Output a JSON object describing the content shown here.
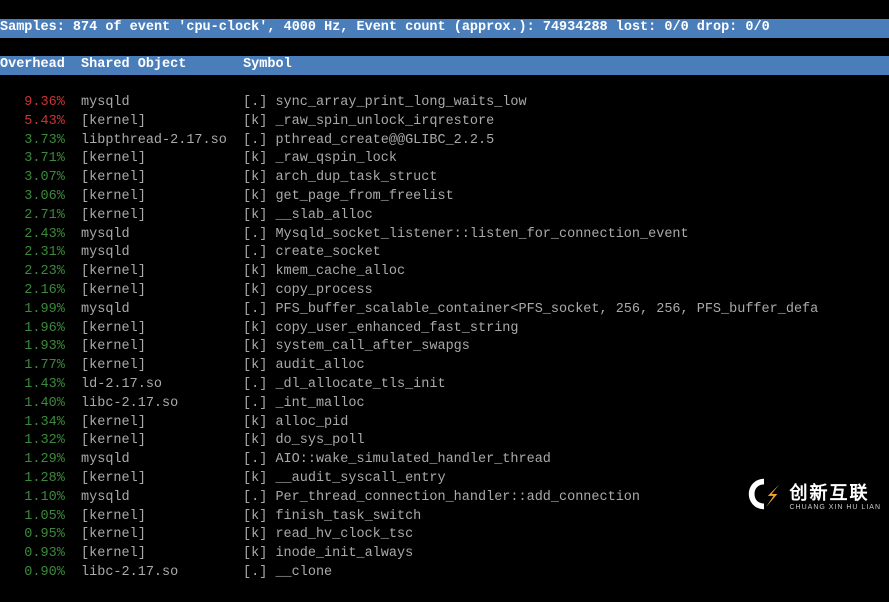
{
  "header": {
    "samples_label": "Samples:",
    "samples": "874",
    "of_event": " of event '",
    "event": "cpu-clock",
    "hz": ", 4000 Hz, Event count (approx.): ",
    "count": "74934288",
    "lost": " lost: 0/0 drop: 0/0"
  },
  "columns": {
    "overhead": "Overhead",
    "shared": "Shared Object",
    "symbol": "Symbol"
  },
  "rows": [
    {
      "pct": "9.36%",
      "obj": "mysqld",
      "flag": "[.]",
      "sym": "sync_array_print_long_waits_low",
      "c": "pct-high"
    },
    {
      "pct": "5.43%",
      "obj": "[kernel]",
      "flag": "[k]",
      "sym": "_raw_spin_unlock_irqrestore",
      "c": "pct-high"
    },
    {
      "pct": "3.73%",
      "obj": "libpthread-2.17.so",
      "flag": "[.]",
      "sym": "pthread_create@@GLIBC_2.2.5",
      "c": "pct-low"
    },
    {
      "pct": "3.71%",
      "obj": "[kernel]",
      "flag": "[k]",
      "sym": "_raw_qspin_lock",
      "c": "pct-low"
    },
    {
      "pct": "3.07%",
      "obj": "[kernel]",
      "flag": "[k]",
      "sym": "arch_dup_task_struct",
      "c": "pct-low"
    },
    {
      "pct": "3.06%",
      "obj": "[kernel]",
      "flag": "[k]",
      "sym": "get_page_from_freelist",
      "c": "pct-low"
    },
    {
      "pct": "2.71%",
      "obj": "[kernel]",
      "flag": "[k]",
      "sym": "__slab_alloc",
      "c": "pct-low"
    },
    {
      "pct": "2.43%",
      "obj": "mysqld",
      "flag": "[.]",
      "sym": "Mysqld_socket_listener::listen_for_connection_event",
      "c": "pct-low"
    },
    {
      "pct": "2.31%",
      "obj": "mysqld",
      "flag": "[.]",
      "sym": "create_socket",
      "c": "pct-low"
    },
    {
      "pct": "2.23%",
      "obj": "[kernel]",
      "flag": "[k]",
      "sym": "kmem_cache_alloc",
      "c": "pct-low"
    },
    {
      "pct": "2.16%",
      "obj": "[kernel]",
      "flag": "[k]",
      "sym": "copy_process",
      "c": "pct-low"
    },
    {
      "pct": "1.99%",
      "obj": "mysqld",
      "flag": "[.]",
      "sym": "PFS_buffer_scalable_container<PFS_socket, 256, 256, PFS_buffer_defa",
      "c": "pct-low"
    },
    {
      "pct": "1.96%",
      "obj": "[kernel]",
      "flag": "[k]",
      "sym": "copy_user_enhanced_fast_string",
      "c": "pct-low"
    },
    {
      "pct": "1.93%",
      "obj": "[kernel]",
      "flag": "[k]",
      "sym": "system_call_after_swapgs",
      "c": "pct-low"
    },
    {
      "pct": "1.77%",
      "obj": "[kernel]",
      "flag": "[k]",
      "sym": "audit_alloc",
      "c": "pct-low"
    },
    {
      "pct": "1.43%",
      "obj": "ld-2.17.so",
      "flag": "[.]",
      "sym": "_dl_allocate_tls_init",
      "c": "pct-low"
    },
    {
      "pct": "1.40%",
      "obj": "libc-2.17.so",
      "flag": "[.]",
      "sym": "_int_malloc",
      "c": "pct-low"
    },
    {
      "pct": "1.34%",
      "obj": "[kernel]",
      "flag": "[k]",
      "sym": "alloc_pid",
      "c": "pct-low"
    },
    {
      "pct": "1.32%",
      "obj": "[kernel]",
      "flag": "[k]",
      "sym": "do_sys_poll",
      "c": "pct-low"
    },
    {
      "pct": "1.29%",
      "obj": "mysqld",
      "flag": "[.]",
      "sym": "AIO::wake_simulated_handler_thread",
      "c": "pct-low"
    },
    {
      "pct": "1.28%",
      "obj": "[kernel]",
      "flag": "[k]",
      "sym": "__audit_syscall_entry",
      "c": "pct-low"
    },
    {
      "pct": "1.10%",
      "obj": "mysqld",
      "flag": "[.]",
      "sym": "Per_thread_connection_handler::add_connection",
      "c": "pct-low"
    },
    {
      "pct": "1.05%",
      "obj": "[kernel]",
      "flag": "[k]",
      "sym": "finish_task_switch",
      "c": "pct-low"
    },
    {
      "pct": "0.95%",
      "obj": "[kernel]",
      "flag": "[k]",
      "sym": "read_hv_clock_tsc",
      "c": "pct-low"
    },
    {
      "pct": "0.93%",
      "obj": "[kernel]",
      "flag": "[k]",
      "sym": "inode_init_always",
      "c": "pct-low"
    },
    {
      "pct": "0.90%",
      "obj": "libc-2.17.so",
      "flag": "[.]",
      "sym": "__clone",
      "c": "pct-low"
    }
  ],
  "watermark": {
    "cn": "创新互联",
    "en": "CHUANG XIN HU LIAN"
  }
}
